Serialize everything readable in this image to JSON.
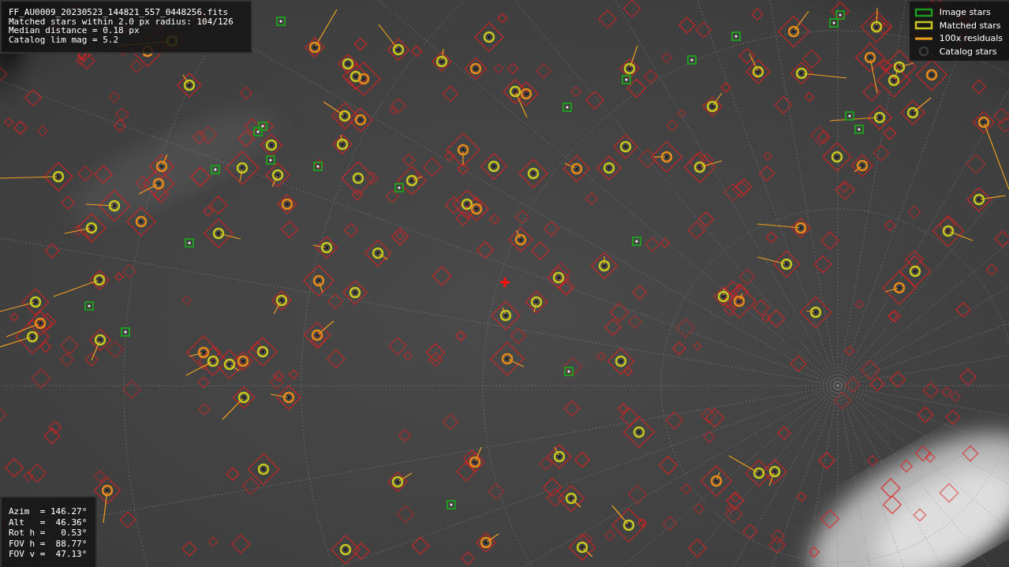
{
  "info_panel": {
    "lines": [
      "FF_AU0009_20230523_144821_557_0448256.fits",
      "Matched stars within 2.0 px radius: 104/126",
      "Median distance = 0.18 px",
      "Catalog lim mag = 5.2"
    ]
  },
  "legend": [
    {
      "kind": "box",
      "label": "Image stars",
      "color": "#1f9a1f"
    },
    {
      "kind": "box",
      "label": "Matched stars",
      "color": "#c8c81e"
    },
    {
      "kind": "line",
      "label": "100x residuals",
      "color": "#f0a020"
    },
    {
      "kind": "circle",
      "label": "Catalog stars",
      "color": "#3a3a3a"
    }
  ],
  "pointing_panel": {
    "lines": [
      "Azim  = 146.27°",
      "Alt   =  46.36°",
      "Rot h =   0.53°",
      "FOV h =  88.77°",
      "FOV v =  47.13°"
    ]
  }
}
